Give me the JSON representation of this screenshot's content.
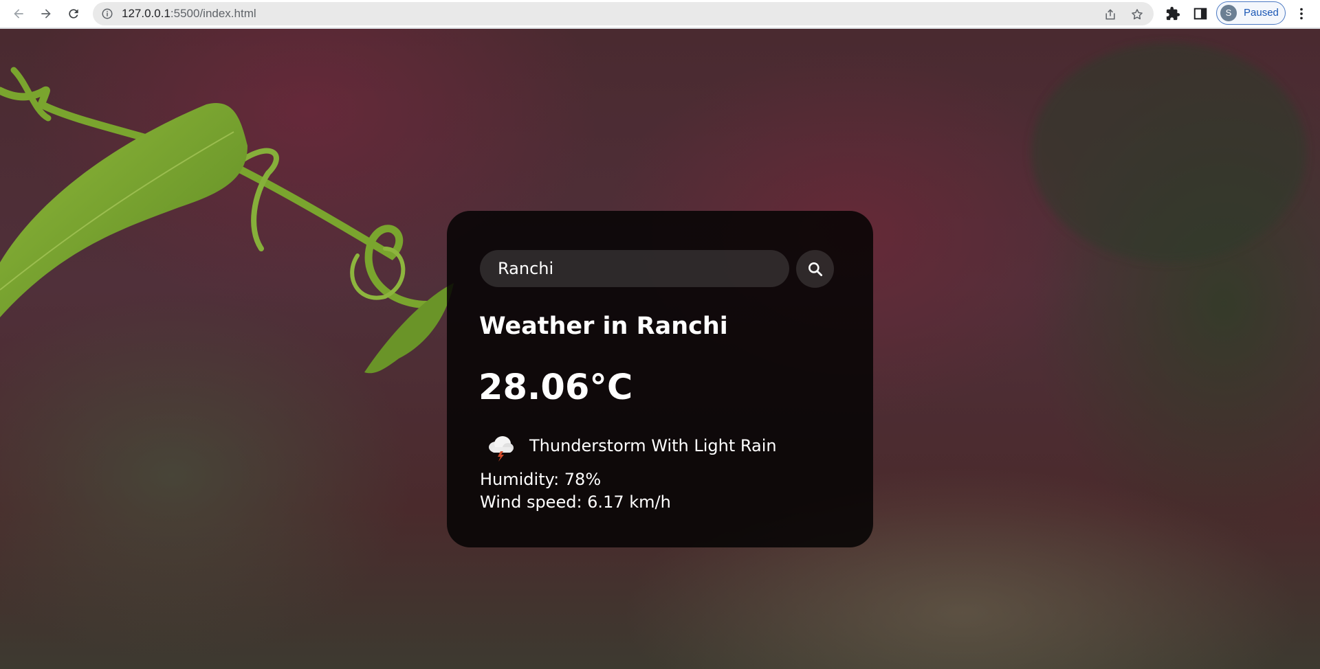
{
  "browser": {
    "url_host": "127.0.0.1",
    "url_path": ":5500/index.html",
    "profile_initial": "S",
    "profile_status": "Paused",
    "icons": [
      "back-arrow-icon",
      "forward-arrow-icon",
      "reload-icon",
      "site-info-icon",
      "share-icon",
      "bookmark-star-icon",
      "extensions-puzzle-icon",
      "side-panel-icon",
      "kebab-menu-icon"
    ]
  },
  "weather": {
    "search_value": "Ranchi",
    "search_icon": "search-icon",
    "title": "Weather in Ranchi",
    "temperature": "28.06°C",
    "condition_icon": "thunderstorm-cloud-icon",
    "description": "Thunderstorm With Light Rain",
    "humidity": "Humidity: 78%",
    "wind": "Wind speed: 6.17 km/h"
  },
  "colors": {
    "card_bg": "#050304",
    "text": "#ffffff",
    "profile_accent": "#1a57b5"
  }
}
